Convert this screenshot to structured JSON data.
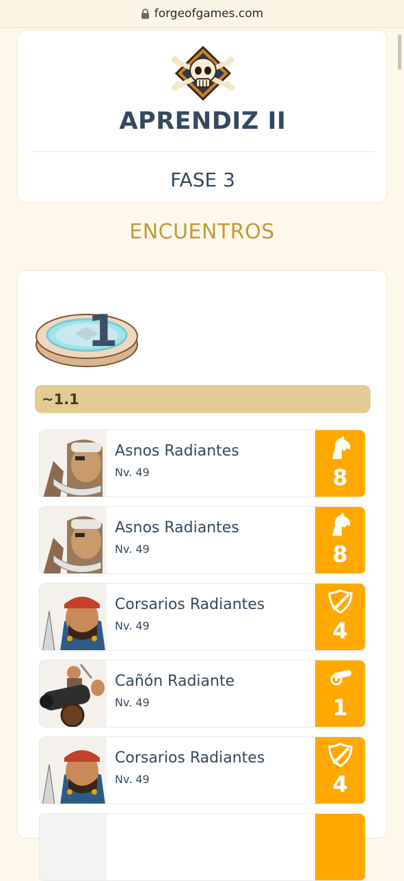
{
  "browser": {
    "url": "forgeofgames.com"
  },
  "header": {
    "rank": "APRENDIZ II",
    "phase": "FASE 3",
    "emblem_icon": "skull-crossbones-icon"
  },
  "section": {
    "title": "ENCUENTROS"
  },
  "encounter": {
    "number": "1",
    "wave": "~1.1",
    "units": [
      {
        "name": "Asnos Radiantes",
        "level": "Nv. 49",
        "type_icon": "horse-icon",
        "count": "8"
      },
      {
        "name": "Asnos Radiantes",
        "level": "Nv. 49",
        "type_icon": "horse-icon",
        "count": "8"
      },
      {
        "name": "Corsarios Radiantes",
        "level": "Nv. 49",
        "type_icon": "sword-shield-icon",
        "count": "4"
      },
      {
        "name": "Cañón Radiante",
        "level": "Nv. 49",
        "type_icon": "cannon-icon",
        "count": "1"
      },
      {
        "name": "Corsarios Radiantes",
        "level": "Nv. 49",
        "type_icon": "sword-shield-icon",
        "count": "4"
      }
    ]
  },
  "colors": {
    "accent": "#ffa900",
    "heading": "#c49a3a",
    "wave_bar": "#e2cc93",
    "text": "#34495e"
  }
}
